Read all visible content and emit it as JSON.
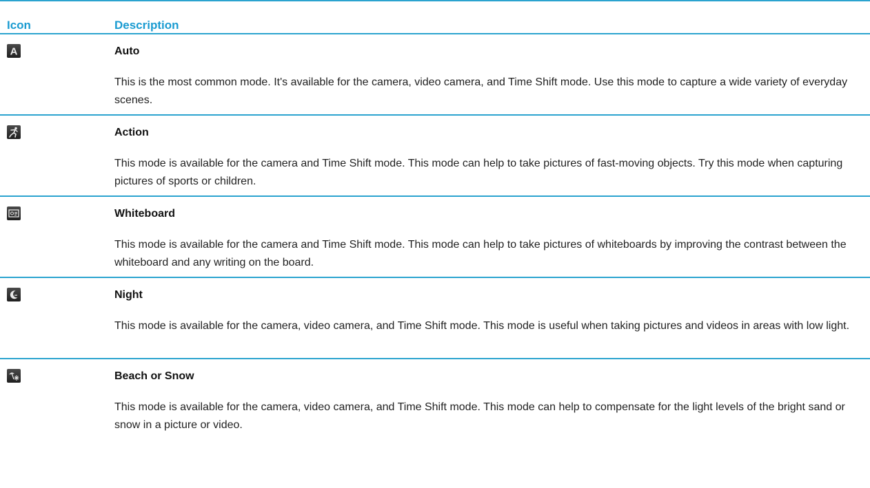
{
  "header": {
    "icon_label": "Icon",
    "description_label": "Description"
  },
  "modes": [
    {
      "icon": "auto-a-icon",
      "title": "Auto",
      "description": "This is the most common mode. It's available for the camera, video camera, and Time Shift mode. Use this mode to capture a wide variety of everyday scenes."
    },
    {
      "icon": "action-runner-icon",
      "title": "Action",
      "description": "This mode is available for the camera and Time Shift mode. This mode can help to take pictures of fast-moving objects. Try this mode when capturing pictures of sports or children."
    },
    {
      "icon": "whiteboard-icon",
      "title": "Whiteboard",
      "description": "This mode is available for the camera and Time Shift mode. This mode can help to take pictures of whiteboards by improving the contrast between the whiteboard and any writing on the board."
    },
    {
      "icon": "night-moon-icon",
      "title": "Night",
      "description": "This mode is available for the camera, video camera, and Time Shift mode. This mode is useful when taking pictures and videos in areas with low light."
    },
    {
      "icon": "beach-snow-icon",
      "title": "Beach or Snow",
      "description": "This mode is available for the camera, video camera, and Time Shift mode. This mode can help to compensate for the light levels of the bright sand or snow in a picture or video."
    }
  ],
  "colors": {
    "accent": "#1a9bd1",
    "rule": "#2aa3cf",
    "icon_bg": "#2b2b2b"
  }
}
